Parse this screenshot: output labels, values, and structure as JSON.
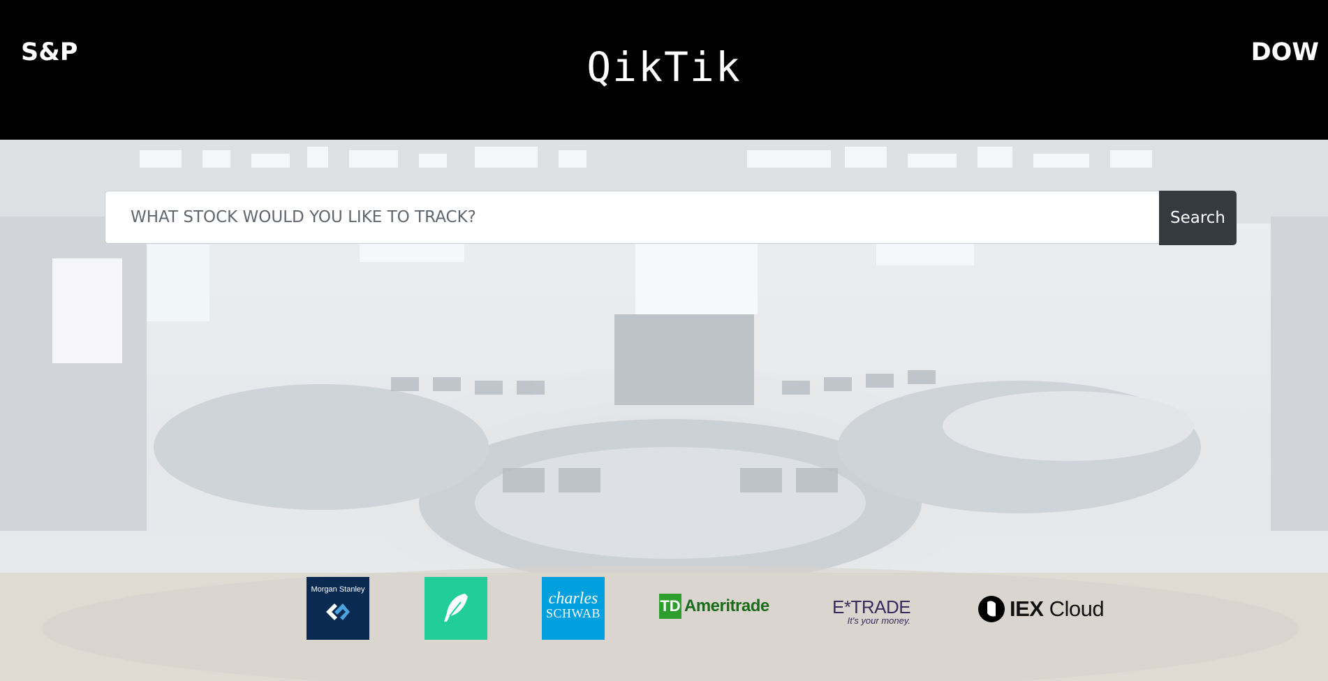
{
  "header": {
    "left_link": "S&P",
    "brand": "QikTik",
    "right_link": "DOW"
  },
  "search": {
    "placeholder": "WHAT STOCK WOULD YOU LIKE TO TRACK?",
    "button_label": "Search"
  },
  "logos": {
    "morgan_stanley": "Morgan Stanley",
    "robinhood_icon": "feather-icon",
    "schwab_line1": "charles",
    "schwab_line2": "SCHWAB",
    "td_mark": "TD",
    "td_name": "Ameritrade",
    "etrade_name": "E*TRADE",
    "etrade_tagline": "It's your money.",
    "iex_name_bold": "IEX",
    "iex_name_light": " Cloud"
  },
  "colors": {
    "header_bg": "#000000",
    "button_bg": "#343a40",
    "morgan_stanley_bg": "#0b2a52",
    "robinhood_bg": "#21ce99",
    "schwab_bg": "#00a0df",
    "td_green": "#2b9e2b"
  }
}
